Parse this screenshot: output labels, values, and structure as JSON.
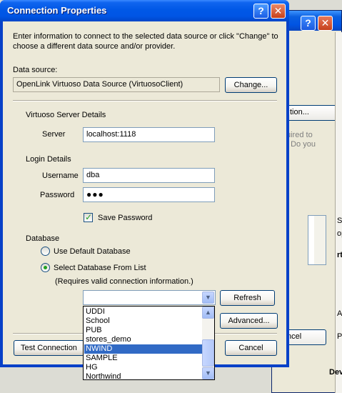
{
  "background_window": {
    "fragment_label": "?",
    "fragment_button": "tion...",
    "fragment_grey": [
      "uired to",
      ". Do you"
    ],
    "fragment_cancel": "ncel",
    "fragment_right": [
      "S",
      "op",
      "rt",
      "A",
      "P"
    ],
    "fragment_bottom": "Dev"
  },
  "dialog": {
    "title": "Connection Properties",
    "help_glyph": "?",
    "close_glyph": "✕",
    "intro": "Enter information to connect to the selected data source or click \"Change\" to choose a different data source and/or provider.",
    "data_source": {
      "label": "Data source:",
      "value": "OpenLink Virtuoso Data Source (VirtuosoClient)",
      "change_button": "Change..."
    },
    "server_details": {
      "heading": "Virtuoso Server Details",
      "server_label": "Server",
      "server_value": "localhost:1118"
    },
    "login": {
      "heading": "Login Details",
      "username_label": "Username",
      "username_value": "dba",
      "password_label": "Password",
      "password_value": "●●●",
      "save_password_label": "Save Password",
      "save_password_checked": true
    },
    "database": {
      "heading": "Database",
      "option_default": "Use Default Database",
      "option_list": "Select Database From List",
      "note": "(Requires valid connection information.)",
      "selected_option": "list",
      "combo_value": "",
      "refresh_button": "Refresh",
      "advanced_button": "Advanced...",
      "dropdown_items": [
        "UDDI",
        "School",
        "PUB",
        "stores_demo",
        "NWIND",
        "SAMPLE",
        "HG",
        "Northwind"
      ],
      "dropdown_selected": "NWIND"
    },
    "buttons": {
      "test_connection": "Test Connection",
      "cancel": "Cancel"
    }
  }
}
